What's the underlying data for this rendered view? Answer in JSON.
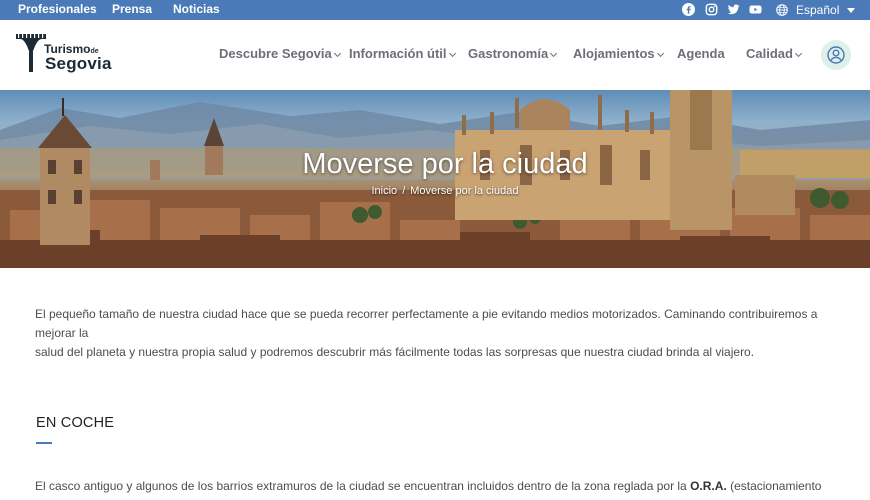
{
  "topbar": {
    "links": [
      "Profesionales",
      "Prensa",
      "Noticias"
    ],
    "social_icons": [
      "facebook-icon",
      "instagram-icon",
      "twitter-icon",
      "youtube-icon"
    ],
    "language": "Español"
  },
  "header": {
    "logo": {
      "line1": "Turismo",
      "line1_suffix": "de",
      "line2": "Segovia"
    },
    "nav": [
      "Descubre Segovia",
      "Información útil",
      "Gastronomía",
      "Alojamientos",
      "Agenda",
      "Calidad"
    ],
    "user_icon": "user-icon"
  },
  "hero": {
    "title": "Moverse por la ciudad",
    "breadcrumb": [
      "Inicio",
      "Moverse por la ciudad"
    ],
    "breadcrumb_sep": "/"
  },
  "content": {
    "intro_line1": "El pequeño tamaño de nuestra ciudad hace que se pueda recorrer perfectamente a pie evitando medios motorizados. Caminando contribuiremos a mejorar la",
    "intro_line2": "salud del planeta y nuestra propia salud y podremos descubrir más fácilmente todas las sorpresas que nuestra ciudad brinda al viajero.",
    "section_title": "EN COCHE",
    "car_text_before": "El casco antiguo y algunos de los barrios extramuros de la ciudad se encuentran incluidos dentro de la zona reglada por la ",
    "car_text_bold": "O.R.A.",
    "car_text_after": " (estacionamiento previo pago"
  },
  "colors": {
    "topbar": "#4a7ab8",
    "accent": "#4a7ab8",
    "user_bg": "#dff0ea"
  }
}
